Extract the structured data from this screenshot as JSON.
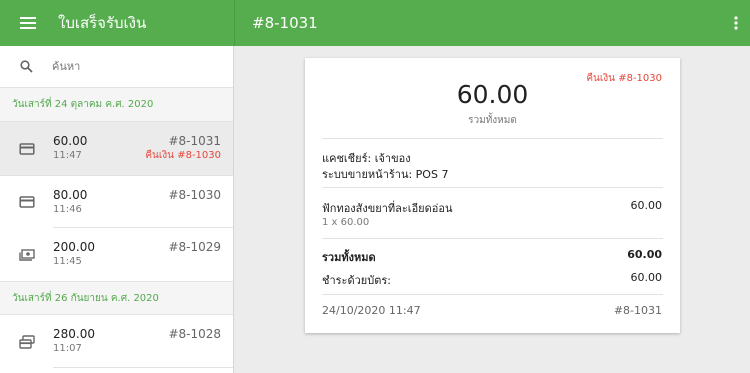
{
  "app": {
    "title": "ใบเสร็จรับเงิน",
    "menu_icon": "menu-icon"
  },
  "header": {
    "receipt_number": "#8-1031",
    "overflow_icon": "more-vert-icon"
  },
  "search": {
    "placeholder": "ค้นหา",
    "icon": "search-icon"
  },
  "colors": {
    "accent": "#55ad4e",
    "refund": "#e5473b"
  },
  "groups": [
    {
      "date": "วันเสาร์ที่ 24 ตุลาคม ค.ศ. 2020",
      "items": [
        {
          "amount": "60.00",
          "time": "11:47",
          "number": "#8-1031",
          "refund": "คืนเงิน #8-1030",
          "icon": "card-icon"
        },
        {
          "amount": "80.00",
          "time": "11:46",
          "number": "#8-1030",
          "refund": "",
          "icon": "card-icon"
        },
        {
          "amount": "200.00",
          "time": "11:45",
          "number": "#8-1029",
          "refund": "",
          "icon": "cash-icon"
        }
      ]
    },
    {
      "date": "วันเสาร์ที่ 26 กันยายน ค.ศ. 2020",
      "items": [
        {
          "amount": "280.00",
          "time": "11:07",
          "number": "#8-1028",
          "refund": "",
          "icon": "multiple-payment-icon"
        }
      ]
    }
  ],
  "receipt": {
    "refund_tag": "คืนเงิน #8-1030",
    "total": "60.00",
    "total_caption": "รวมทั้งหมด",
    "cashier": "แคชเชียร์: เจ้าของ",
    "pos": "ระบบขายหน้าร้าน: POS 7",
    "item_name": "ฟักทองสังขยาที่ละเอียดอ่อน",
    "item_price": "60.00",
    "item_qty": "1 x 60.00",
    "total_label": "รวมทั้งหมด",
    "total_value": "60.00",
    "payment_label": "ชำระด้วยบัตร:",
    "payment_value": "60.00",
    "datetime": "24/10/2020 11:47",
    "number": "#8-1031"
  }
}
